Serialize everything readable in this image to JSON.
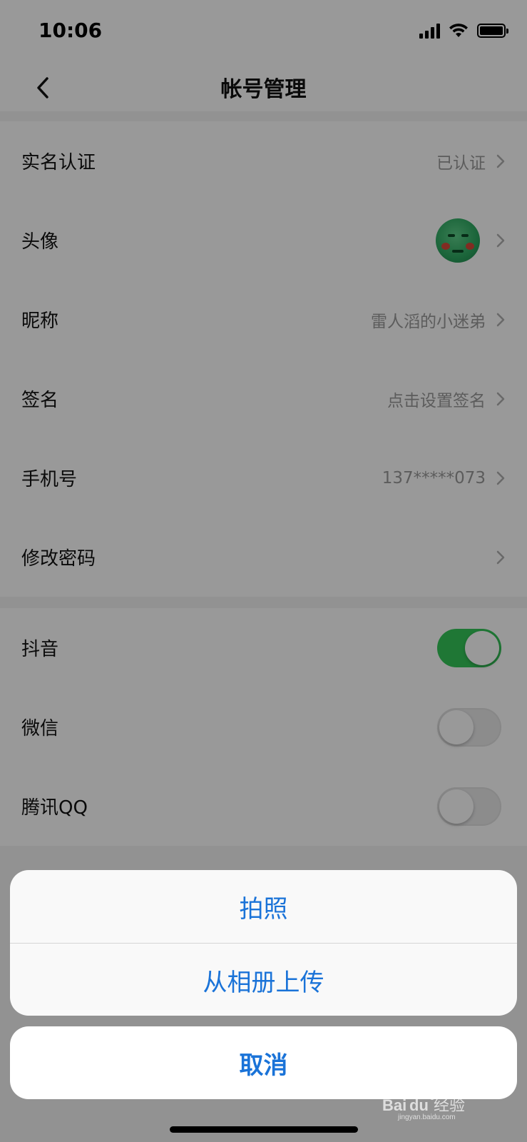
{
  "status_bar": {
    "time": "10:06",
    "icons": [
      "signal-icon",
      "wifi-icon",
      "battery-icon"
    ]
  },
  "nav": {
    "title": "帐号管理",
    "back_icon": "chevron-left-icon"
  },
  "account_items": [
    {
      "label": "实名认证",
      "value": "已认证"
    },
    {
      "label": "头像",
      "value": ""
    },
    {
      "label": "昵称",
      "value": "雷人滔的小迷弟"
    },
    {
      "label": "签名",
      "value": "点击设置签名"
    },
    {
      "label": "手机号",
      "value": "137*****073"
    },
    {
      "label": "修改密码",
      "value": ""
    }
  ],
  "linked_accounts": [
    {
      "label": "抖音",
      "enabled": true
    },
    {
      "label": "微信",
      "enabled": false
    },
    {
      "label": "腾讯QQ",
      "enabled": false
    }
  ],
  "action_sheet": {
    "options": [
      "拍照",
      "从相册上传"
    ],
    "cancel": "取消"
  },
  "watermark": {
    "text": "Baidu经验",
    "url": "jingyan.baidu.com"
  },
  "colors": {
    "accent": "#1a73d8",
    "toggle_on": "#34c759",
    "overlay": "rgba(0,0,0,0.4)"
  }
}
